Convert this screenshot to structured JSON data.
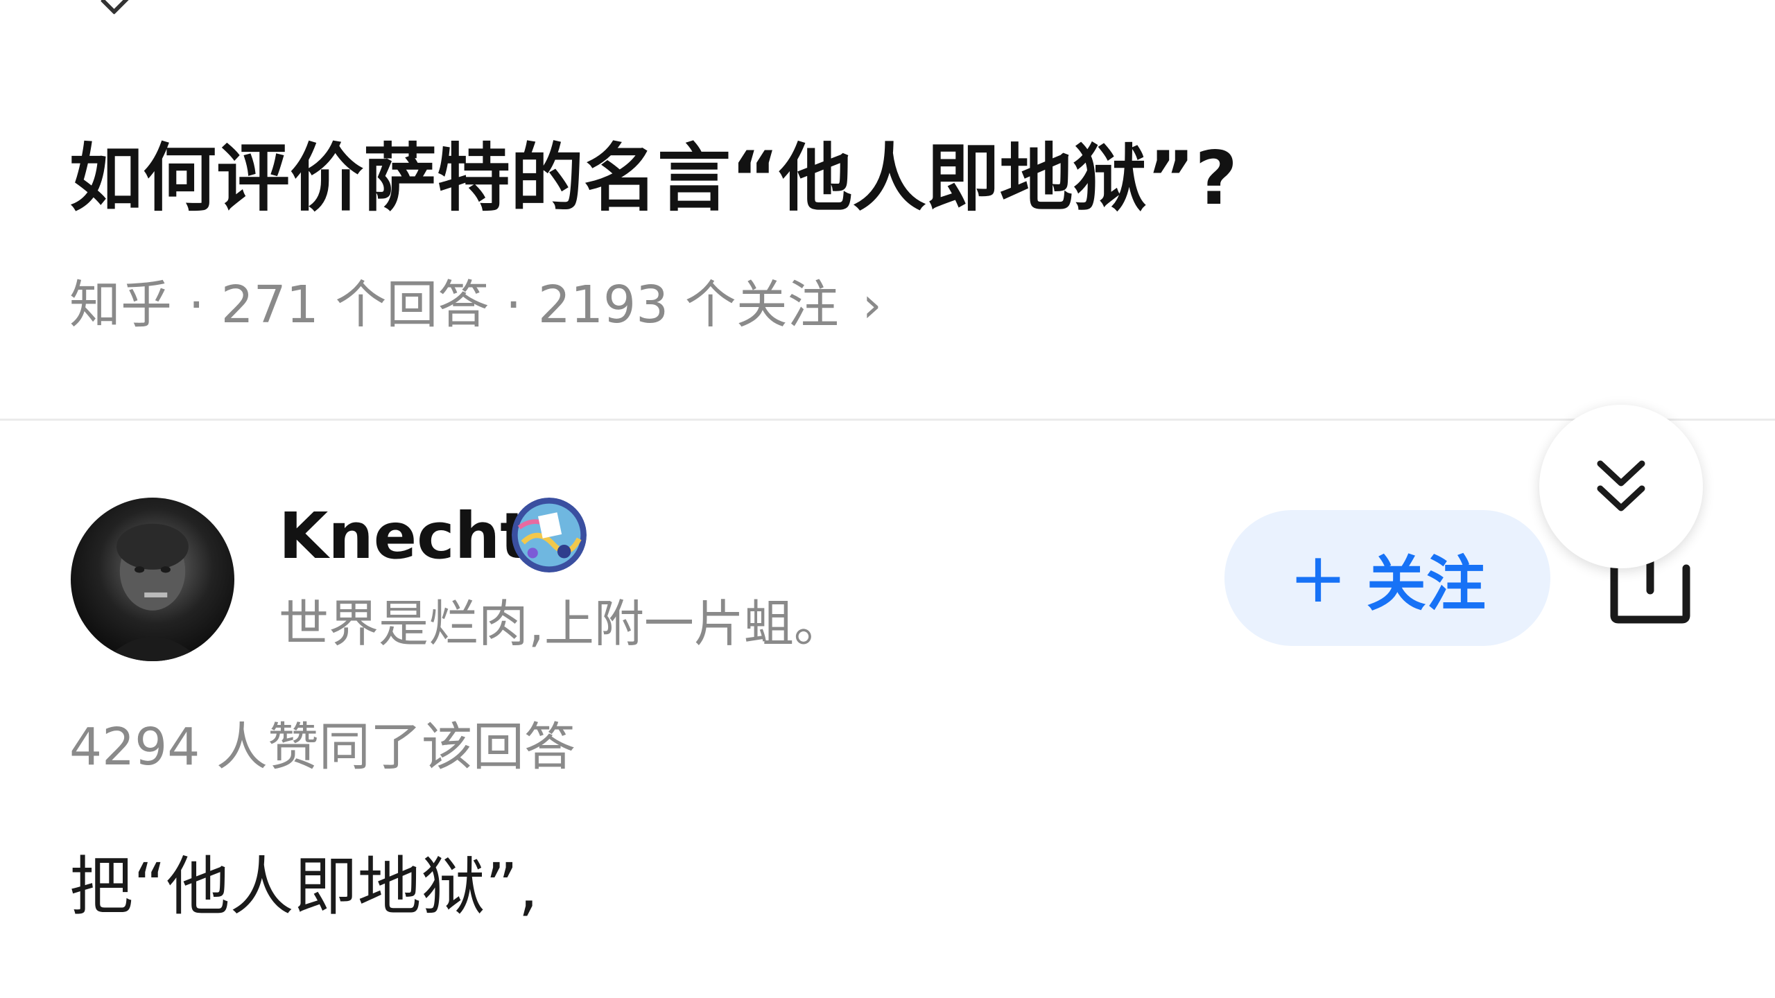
{
  "question": {
    "title": "如何评价萨特的名言“他人即地狱”?",
    "meta": "知乎 · 271 个回答 · 2193 个关注",
    "meta_chevron": "›"
  },
  "author": {
    "name": "Knecht",
    "bio": "世界是烂肉,上附一片蛆。",
    "avatar_icon": "avatar",
    "badge_icon": "badge-icon"
  },
  "follow_button": {
    "plus": "+",
    "label": "关注"
  },
  "icons": {
    "share": "share-icon",
    "collapse": "double-chevron-down-icon"
  },
  "answer": {
    "votes": "4294 人赞同了该回答",
    "first_line": "把“他人即地狱”,"
  },
  "colors": {
    "accent": "#1772f6",
    "follow_bg": "#eaf2fe",
    "meta_gray": "#8a8a8a",
    "title": "#121212"
  }
}
